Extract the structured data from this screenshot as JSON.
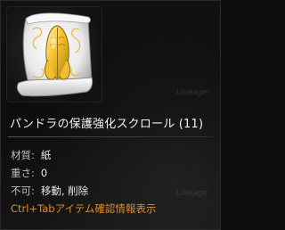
{
  "item": {
    "name": "パンドラの保護強化スクロール (11)",
    "icon": "praying-hands-scroll-icon"
  },
  "stats": {
    "material_label": "材質:",
    "material_value": "紙",
    "weight_label": "重さ:",
    "weight_value": "0",
    "restrict_label": "不可:",
    "restrict_value": "移動, 削除"
  },
  "hint": "Ctrl+Tabアイテム確認情報表示",
  "watermark": "Lineage",
  "colors": {
    "hint": "#e08a2c",
    "name": "#f2f2f2",
    "background": "#0d0d0d"
  }
}
